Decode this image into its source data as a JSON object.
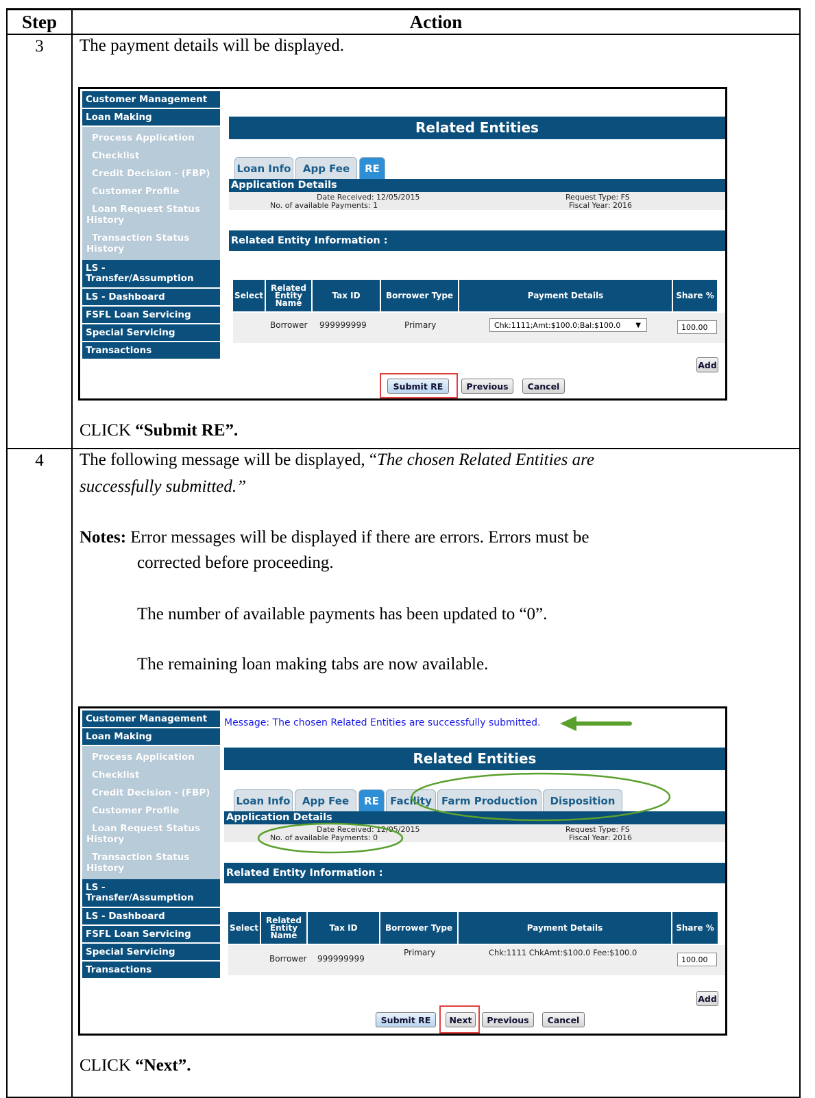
{
  "table": {
    "header_step": "Step",
    "header_action": "Action"
  },
  "step3": {
    "num": "3",
    "intro": "The payment details will be displayed.",
    "click_prefix": "CLICK ",
    "click_target": "“Submit RE”."
  },
  "step4": {
    "num": "4",
    "intro_prefix": "The following message will be displayed, “",
    "intro_italic_1": "The chosen Related Entities are",
    "intro_italic_2": "successfully submitted.”",
    "notes_label": "Notes:",
    "notes_1a": " Error messages will be displayed if there are errors.  Errors must be",
    "notes_1b": "corrected before proceeding.",
    "notes_2": "The number of available payments has been updated to “0”.",
    "notes_3": "The remaining loan making tabs are now available.",
    "click_prefix": "CLICK ",
    "click_target": "“Next”."
  },
  "sidebar": {
    "customer_management": "Customer Management",
    "loan_making": "Loan Making",
    "process_application": "Process Application",
    "checklist": "Checklist",
    "credit_decision": "Credit Decision - (FBP)",
    "customer_profile": "Customer Profile",
    "loan_request_status_1": "Loan Request Status",
    "loan_request_status_2": "History",
    "transaction_status_1": "Transaction Status",
    "transaction_status_2": "History",
    "ls_transfer_1": "LS -",
    "ls_transfer_2": "Transfer/Assumption",
    "ls_dashboard": "LS - Dashboard",
    "fsfl_loan_servicing": "FSFL Loan Servicing",
    "special_servicing": "Special Servicing",
    "transactions": "Transactions"
  },
  "screen": {
    "title": "Related Entities",
    "message": "Message: The chosen Related Entities are successfully submitted.",
    "tabs": {
      "loan_info": "Loan Info",
      "app_fee": "App Fee",
      "re": "RE",
      "facility": "Facility",
      "farm_production": "Farm Production",
      "disposition": "Disposition"
    },
    "app_details": "Application Details",
    "date_received": "Date Received: 12/05/2015",
    "request_type": "Request Type: FS",
    "payments_1": "No. of available Payments: 1",
    "payments_0": "No. of available Payments: 0",
    "fiscal_year": "Fiscal Year: 2016",
    "rel_info": "Related Entity Information :",
    "cols": {
      "select": "Select",
      "rel_1": "Related",
      "rel_2": "Entity",
      "rel_3": "Name",
      "tax_id": "Tax ID",
      "borrower_type": "Borrower Type",
      "payment_details": "Payment Details",
      "share": "Share %"
    },
    "row": {
      "name": "Borrower",
      "tax_id": "999999999",
      "type": "Primary",
      "payment_select": "Chk:1111;Amt:$100.0;Bal:$100.0",
      "payment_text": "Chk:1111 ChkAmt:$100.0 Fee:$100.0",
      "share": "100.00"
    },
    "buttons": {
      "add": "Add",
      "submit_re": "Submit RE",
      "next": "Next",
      "previous": "Previous",
      "cancel": "Cancel"
    }
  },
  "colors": {
    "nav_blue": "#0b4f7c",
    "highlight_red": "#e04040",
    "annotation_green": "#5aa02c",
    "message_blue": "#1a1ae8"
  }
}
